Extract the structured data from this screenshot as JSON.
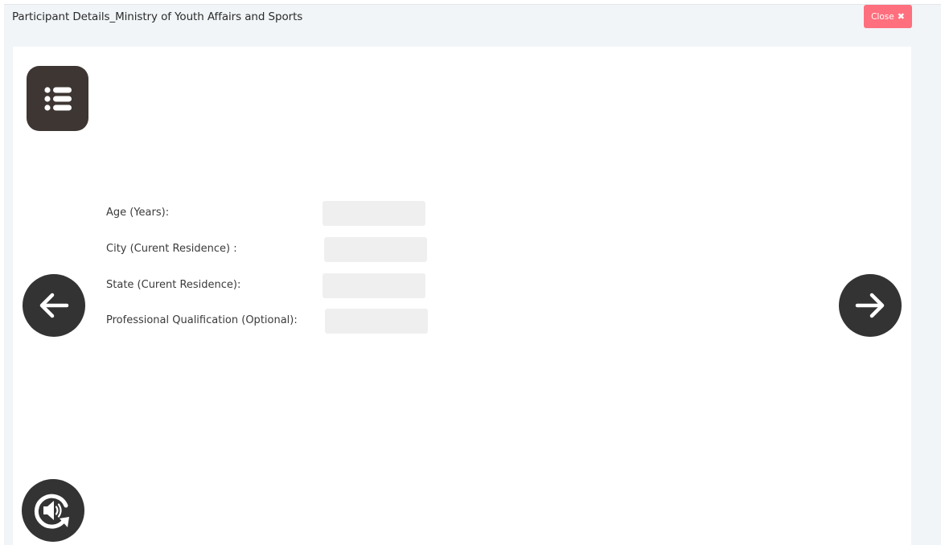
{
  "modal": {
    "title": "Participant Details_Ministry of Youth Affairs and Sports",
    "close_label": "Close",
    "close_icon": "✖"
  },
  "colors": {
    "close_button": "#ff6f7e",
    "icon_button": "#333333",
    "menu_button": "#3e3633",
    "input_bg": "#efefef",
    "modal_bg": "#f1f5f8"
  },
  "icons": {
    "menu": "list-icon",
    "prev": "arrow-left-icon",
    "next": "arrow-right-icon",
    "audio": "audio-replay-icon"
  },
  "form": {
    "fields": [
      {
        "label": "Age (Years):",
        "value": ""
      },
      {
        "label": "City (Curent Residence) :",
        "value": ""
      },
      {
        "label": "State (Curent Residence):",
        "value": ""
      },
      {
        "label": "Professional Qualification (Optional):",
        "value": ""
      }
    ]
  }
}
